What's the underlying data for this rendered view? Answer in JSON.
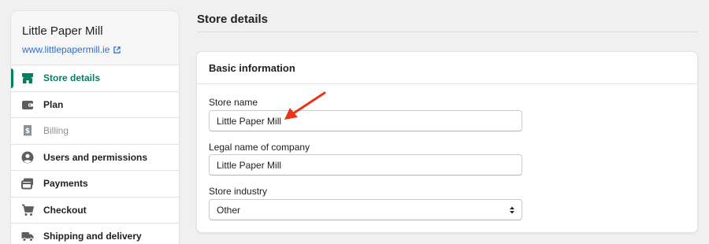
{
  "store": {
    "name": "Little Paper Mill",
    "url": "www.littlepapermill.ie"
  },
  "sidebar": {
    "items": [
      {
        "label": "Store details",
        "icon": "store-icon",
        "state": "active"
      },
      {
        "label": "Plan",
        "icon": "wallet-icon",
        "state": "normal"
      },
      {
        "label": "Billing",
        "icon": "receipt-icon",
        "state": "disabled"
      },
      {
        "label": "Users and permissions",
        "icon": "user-circle-icon",
        "state": "normal"
      },
      {
        "label": "Payments",
        "icon": "credit-card-icon",
        "state": "normal"
      },
      {
        "label": "Checkout",
        "icon": "cart-icon",
        "state": "normal"
      },
      {
        "label": "Shipping and delivery",
        "icon": "truck-icon",
        "state": "normal"
      }
    ]
  },
  "main": {
    "page_title": "Store details",
    "card": {
      "title": "Basic information",
      "fields": [
        {
          "label": "Store name",
          "value": "Little Paper Mill"
        },
        {
          "label": "Legal name of company",
          "value": "Little Paper Mill"
        },
        {
          "label": "Store industry",
          "value": "Other"
        }
      ]
    }
  },
  "colors": {
    "accent_green": "#008060",
    "link_blue": "#2c6ecb",
    "annotation_red": "#e8341c"
  }
}
